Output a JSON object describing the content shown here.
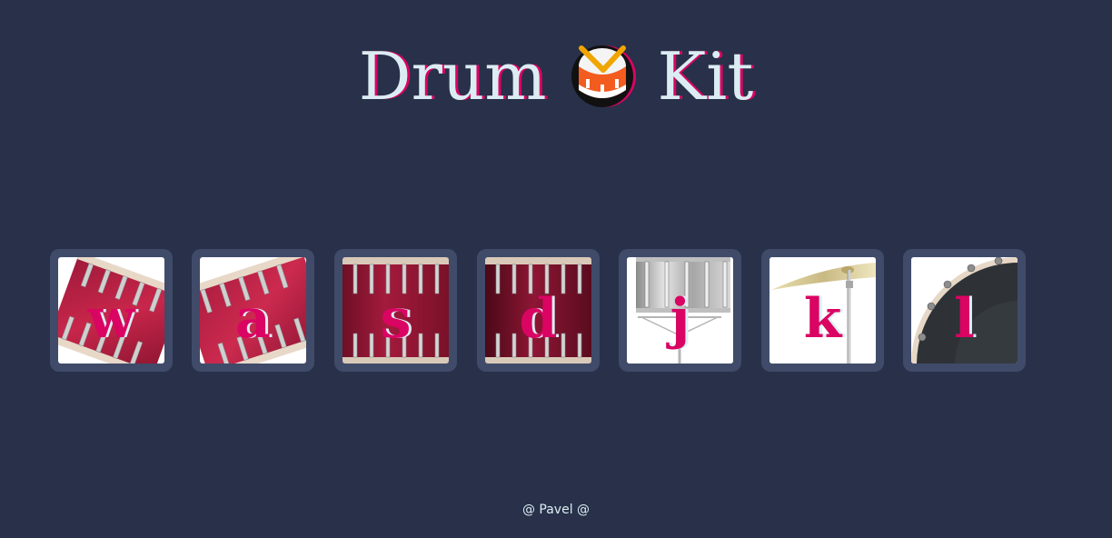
{
  "header": {
    "title_left": "Drum",
    "title_right": "Kit",
    "title_icon": "drum-emoji-icon"
  },
  "pads": [
    {
      "key": "w",
      "instrument": "tom-icon"
    },
    {
      "key": "a",
      "instrument": "tom-icon"
    },
    {
      "key": "s",
      "instrument": "tom-icon"
    },
    {
      "key": "d",
      "instrument": "tom-icon"
    },
    {
      "key": "j",
      "instrument": "snare-icon"
    },
    {
      "key": "k",
      "instrument": "cymbal-icon"
    },
    {
      "key": "l",
      "instrument": "bass-drum-icon"
    }
  ],
  "footer": {
    "credit": "@ Pavel @"
  },
  "colors": {
    "background": "#283149",
    "pad_frame": "#404B69",
    "accent": "#DA0463",
    "text_light": "#DBEDF3"
  }
}
